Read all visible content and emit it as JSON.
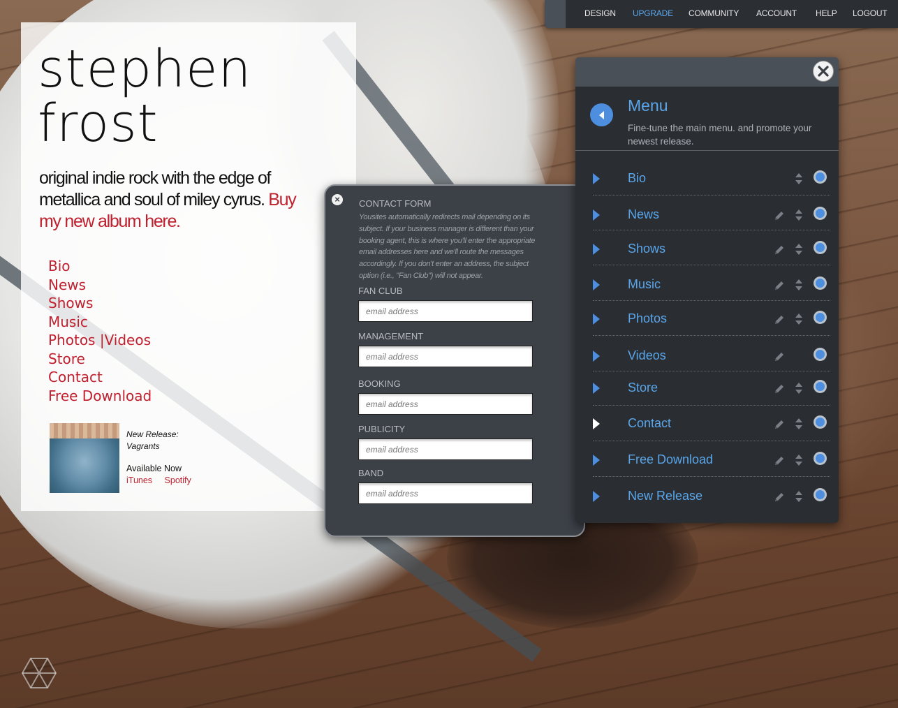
{
  "topnav": {
    "items": [
      {
        "label": "DESIGN"
      },
      {
        "label": "UPGRADE",
        "active": true
      },
      {
        "label": "COMMUNITY"
      },
      {
        "label": "ACCOUNT"
      },
      {
        "label": "HELP"
      },
      {
        "label": "LOGOUT"
      }
    ]
  },
  "site": {
    "title_line1": "stephen",
    "title_line2": "frost",
    "tagline": "original indie rock with the edge of metallica and soul of miley cyrus.",
    "buy_link": "Buy my new album here.",
    "nav": [
      "Bio",
      "News",
      "Shows",
      "Music",
      "Photos |Videos",
      "Store",
      "Contact",
      "Free Download"
    ],
    "release": {
      "label_line1": "New Release:",
      "label_line2": "Vagrants",
      "available": "Available Now",
      "links": [
        "iTunes",
        "Spotify"
      ]
    }
  },
  "contact_form": {
    "title": "CONTACT FORM",
    "description": "Yousites automatically redirects mail depending on its subject. If your business manager is different than your booking agent, this is where you'll enter the appropriate email addresses here and we'll route the messages accordingly. If you don't enter an address, the subject option (i.e., \"Fan Club\") will not appear.",
    "fields": [
      {
        "label": "FAN CLUB",
        "placeholder": "email address"
      },
      {
        "label": "MANAGEMENT",
        "placeholder": "email address"
      },
      {
        "label": "BOOKING",
        "placeholder": "email address"
      },
      {
        "label": "PUBLICITY",
        "placeholder": "email address"
      },
      {
        "label": "BAND",
        "placeholder": "email address"
      }
    ]
  },
  "menu_panel": {
    "title": "Menu",
    "subtitle": "Fine-tune the main menu. and promote your newest release.",
    "items": [
      {
        "label": "Bio",
        "editable": false,
        "sortable": true
      },
      {
        "label": "News",
        "editable": true,
        "sortable": true
      },
      {
        "label": "Shows",
        "editable": true,
        "sortable": true
      },
      {
        "label": "Music",
        "editable": true,
        "sortable": true
      },
      {
        "label": "Photos",
        "editable": true,
        "sortable": true
      },
      {
        "label": "Videos",
        "editable": true,
        "sortable": false
      },
      {
        "label": "Store",
        "editable": true,
        "sortable": true
      },
      {
        "label": "Contact",
        "editable": true,
        "sortable": true,
        "active": true
      },
      {
        "label": "Free Download",
        "editable": true,
        "sortable": true
      },
      {
        "label": "New Release",
        "editable": true,
        "sortable": true
      }
    ]
  },
  "colors": {
    "accent_blue": "#5aa6ea",
    "link_red": "#c0202e",
    "panel_dark": "#2a2e33"
  },
  "icons": {
    "close": "close-icon",
    "back": "back-arrow-icon",
    "edit": "pencil-icon",
    "sort": "sort-icon",
    "toggle": "toggle-dot-icon",
    "expand": "chevron-right-icon",
    "logo": "hexagon-logo-icon"
  }
}
